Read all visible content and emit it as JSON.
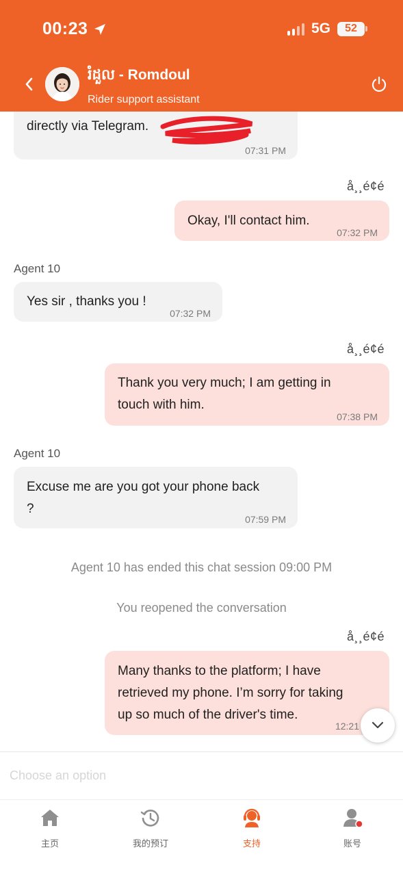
{
  "status_bar": {
    "time": "00:23",
    "network": "5G",
    "battery": "52"
  },
  "header": {
    "name": "រំដួល - Romdoul",
    "role": "Rider support assistant",
    "accent_color": "#ee6228"
  },
  "messages": [
    {
      "direction": "in",
      "text": "directly via Telegram. ",
      "time": "07:31 PM"
    },
    {
      "direction": "out",
      "status": "å¸¸é¢é",
      "text": "Okay, I'll contact him.",
      "time": "07:32 PM"
    },
    {
      "direction": "in",
      "sender": "Agent 10",
      "text": "Yes sir , thanks you !",
      "time": "07:32 PM"
    },
    {
      "direction": "out",
      "status": "å¸¸é¢é",
      "line1": "Thank you very much; I am getting in",
      "line2": "touch with him.",
      "time": "07:38 PM"
    },
    {
      "direction": "in",
      "sender": "Agent 10",
      "line1": "Excuse me are you got your phone back",
      "line2": "?",
      "time": "07:59 PM"
    },
    {
      "direction": "out",
      "status": "å¸¸é¢é",
      "line1": "Many thanks to the platform; I have",
      "line2": "retrieved my phone. I’m sorry for taking",
      "line3": "up so much of the driver's time.",
      "time": "12:21"
    }
  ],
  "system_messages": [
    "Agent 10 has ended this chat session 09:00 PM",
    "You reopened the conversation"
  ],
  "input": {
    "placeholder": "Choose an option"
  },
  "nav": [
    {
      "label": "主页",
      "icon": "home-icon"
    },
    {
      "label": "我的预订",
      "icon": "history-icon"
    },
    {
      "label": "支持",
      "icon": "support-agent-icon",
      "active": true
    },
    {
      "label": "账号",
      "icon": "account-icon"
    }
  ]
}
